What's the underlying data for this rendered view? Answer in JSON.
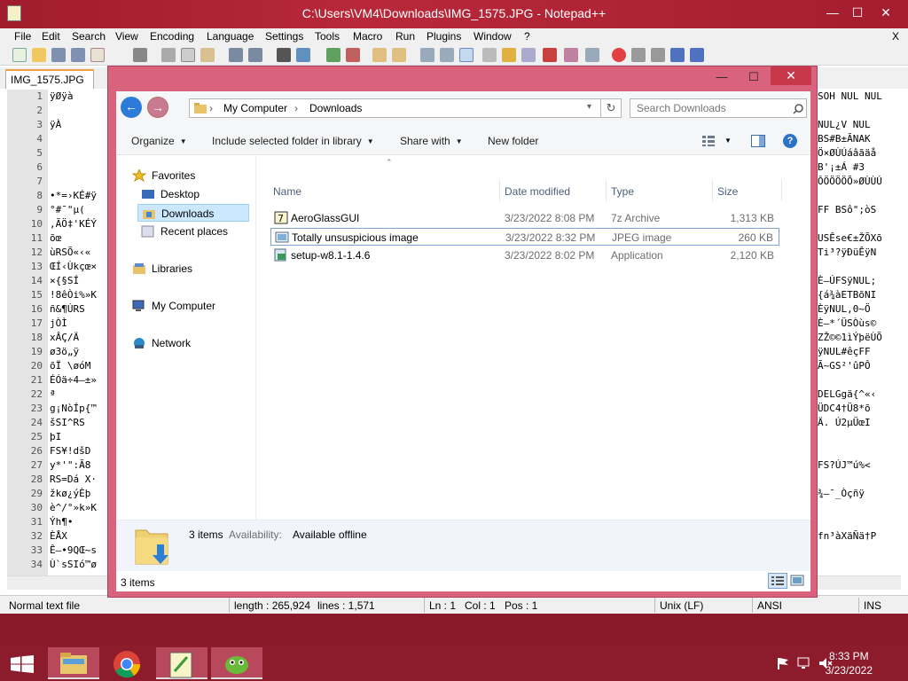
{
  "notepad": {
    "title": "C:\\Users\\VM4\\Downloads\\IMG_1575.JPG - Notepad++",
    "window_controls": {
      "minimize": "—",
      "maximize": "☐",
      "close": "✕"
    },
    "menu": [
      "File",
      "Edit",
      "Search",
      "View",
      "Encoding",
      "Language",
      "Settings",
      "Tools",
      "Macro",
      "Run",
      "Plugins",
      "Window",
      "?"
    ],
    "menu_close": "X",
    "tab_label": "IMG_1575.JPG",
    "line_numbers": [
      "1",
      "2",
      "3",
      "4",
      "5",
      "6",
      "7",
      "8",
      "9",
      "10",
      "11",
      "12",
      "13",
      "14",
      "15",
      "16",
      "17",
      "18",
      "19",
      "20",
      "21",
      "22",
      "23",
      "24",
      "25",
      "26",
      "27",
      "28",
      "29",
      "30",
      "31",
      "32",
      "33",
      "34"
    ],
    "visible_left_text": [
      "ÿØÿà",
      "",
      "ÿÀ",
      "",
      "",
      "",
      "",
      "•*=›KÉ#ÿ",
      "°#¯\"µ(",
      ",ÃÖ‡'KÉÝ",
      "õœ",
      "ùRSÕ«‹«",
      "ŒÍ‹Ùkçœ×",
      "×{§SÍ",
      "!8êÒi%»K",
      "ñ&¶ÚRS",
      "jÒÌ",
      "xÂÇ/Ä",
      "ø3ö„ÿ",
      "õÏ  \\øóM",
      "ÉÓä÷4–±»",
      "ª",
      "g¡NòÍp{™",
      "šSI^RS",
      "þI",
      "FS¥!dšD",
      "y*'\":Ã8",
      "RS=Dá X·",
      "žkø¿ýÈþ",
      "è^/°»k»K",
      "Ýh¶•",
      "ÈÅX",
      "Ê–•9QŒ~s",
      "Ù`sSIó™ø"
    ],
    "visible_right_text": [
      "SOH NUL NUL",
      "",
      "NUL¿V NUL",
      "BS#B±ÃNAK",
      "Ö×ØÙÚáâãäå",
      "B'¡±Á   #3",
      "ÔÖÖÖÖÕ»ØÙÙÚ",
      "",
      "FF BSô\";òS",
      "",
      "USÊse€±ŽÕXõ",
      "Ti³?ÿÐüÊÿN",
      "",
      "È–ÚFSÿNUL;",
      "{á¾àETBõNI",
      "ÈÿNUL,0~Ö",
      "È–*´ÜSÒùs©",
      "ZŽ©©1ìÝþëÙÕ",
      "ÿNUL#êçFF",
      "Ã~GS²'ûPÔ",
      "",
      "DELGgä{^«‹",
      "ÜDC4†Ü8*õ",
      "Ä.  Ú2µÜœI",
      "",
      "",
      "FS?ÚJ™ú%<",
      "",
      "¾–¯_Òçñÿ",
      "",
      "",
      "fn³àXäÑä†P",
      ""
    ],
    "status": {
      "type": "Normal text file",
      "length": "length : 265,924",
      "lines": "lines : 1,571",
      "ln": "Ln : 1",
      "col": "Col : 1",
      "pos": "Pos : 1",
      "eol": "Unix (LF)",
      "encoding": "ANSI",
      "mode": "INS"
    }
  },
  "explorer": {
    "window_controls": {
      "minimize": "—",
      "maximize": "☐",
      "close": "✕"
    },
    "back_label": "←",
    "forward_label": "→",
    "breadcrumb": [
      "My Computer",
      "Downloads"
    ],
    "refresh_label": "↻",
    "search_placeholder": "Search Downloads",
    "commands": [
      "Organize",
      "Include selected folder in library",
      "Share with",
      "New folder"
    ],
    "help_label": "?",
    "nav": {
      "favorites": "Favorites",
      "desktop": "Desktop",
      "downloads": "Downloads",
      "recent": "Recent places",
      "libraries": "Libraries",
      "computer": "My Computer",
      "network": "Network"
    },
    "columns": [
      "Name",
      "Date modified",
      "Type",
      "Size"
    ],
    "files": [
      {
        "name": "AeroGlassGUI",
        "date": "3/23/2022 8:08 PM",
        "type": "7z Archive",
        "size": "1,313 KB"
      },
      {
        "name": "Totally unsuspicious image",
        "date": "3/23/2022 8:32 PM",
        "type": "JPEG image",
        "size": "260 KB"
      },
      {
        "name": "setup-w8.1-1.4.6",
        "date": "3/23/2022 8:02 PM",
        "type": "Application",
        "size": "2,120 KB"
      }
    ],
    "details": {
      "count": "3 items",
      "availability_label": "Availability:",
      "availability_value": "Available offline"
    },
    "status_count": "3 items"
  },
  "taskbar": {
    "time": "8:33 PM",
    "date": "3/23/2022"
  },
  "colors": {
    "accent": "#c2465f",
    "title_bar": "#a01c2c",
    "taskbar": "#8c1c2c",
    "selection_border": "#7da2ce"
  }
}
